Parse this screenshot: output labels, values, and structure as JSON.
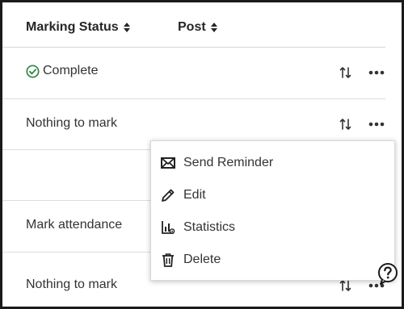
{
  "table": {
    "headers": {
      "marking_status": "Marking Status",
      "post": "Post"
    },
    "rows": [
      {
        "status": "Complete",
        "status_icon": "check-circle-icon"
      },
      {
        "status": "Nothing to mark"
      },
      {
        "status": ""
      },
      {
        "status": "Mark attendance"
      },
      {
        "status": "Nothing to mark"
      }
    ]
  },
  "context_menu": {
    "items": [
      {
        "label": "Send Reminder",
        "icon": "envelope-icon"
      },
      {
        "label": "Edit",
        "icon": "pencil-icon"
      },
      {
        "label": "Statistics",
        "icon": "statistics-icon"
      },
      {
        "label": "Delete",
        "icon": "trash-icon"
      }
    ]
  },
  "colors": {
    "complete_green": "#2e8540",
    "text": "#2b2b2b",
    "divider": "#d6d6d6"
  }
}
